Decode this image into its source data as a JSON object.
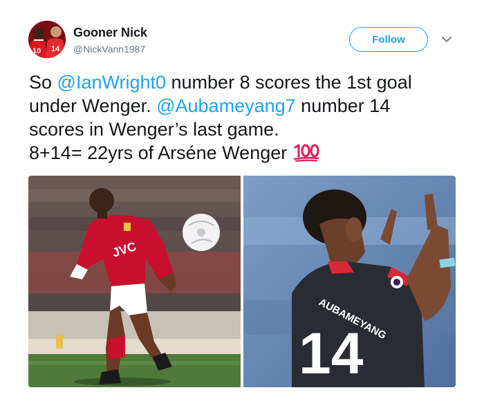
{
  "tweet": {
    "display_name": "Gooner Nick",
    "handle": "@NickVann1987",
    "follow_label": "Follow",
    "avatar": {
      "shirt_numbers": [
        "10",
        "14"
      ]
    },
    "text": {
      "line1": {
        "pre": "So ",
        "mention": "@IanWright0",
        "post": " number 8 scores the 1st goal"
      },
      "line2": {
        "pre": "under Wenger. ",
        "mention": "@Aubameyang7",
        "post": " number 14"
      },
      "line3": "scores in Wenger’s last game.",
      "line4": "8+14= 22yrs of Arséne Wenger",
      "emoji": "hundred-points"
    },
    "media": {
      "left": {
        "sponsor": "JVC",
        "kit_color": "#c8102e"
      },
      "right": {
        "shirt_name": "AUBAMEYANG",
        "shirt_number": "14",
        "kit_color": "#2a2c33"
      }
    }
  },
  "colors": {
    "link": "#1da1f2",
    "text": "#14171a",
    "muted": "#657786",
    "emoji_red": "#e0245e"
  }
}
